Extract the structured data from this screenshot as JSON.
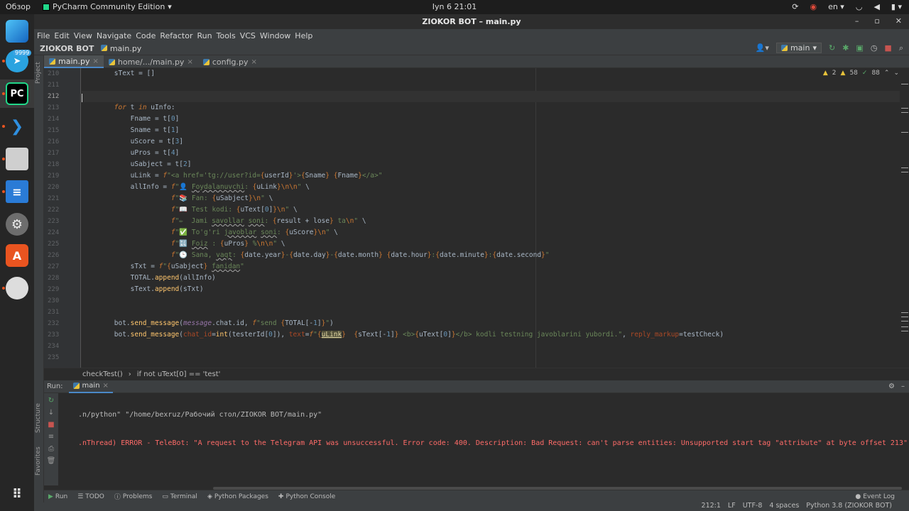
{
  "system": {
    "activities": "Обзор",
    "app_menu": "PyCharm Community Edition",
    "clock": "Iyn 6  21:01",
    "lang": "en"
  },
  "dock": {
    "badge": "9999",
    "pycharm_label": "PC"
  },
  "window": {
    "title": "ZIOKOR BOT – main.py"
  },
  "menu": [
    "File",
    "Edit",
    "View",
    "Navigate",
    "Code",
    "Refactor",
    "Run",
    "Tools",
    "VCS",
    "Window",
    "Help"
  ],
  "nav": {
    "project": "ZIOKOR BOT",
    "file": "main.py",
    "branch": "main"
  },
  "sidebar": {
    "project": "Project",
    "structure": "Structure",
    "favorites": "Favorites"
  },
  "tabs": [
    {
      "label": "main.py"
    },
    {
      "label": "home/.../main.py"
    },
    {
      "label": "config.py"
    }
  ],
  "inspections": {
    "warnings": "2",
    "weak": "58",
    "typos": "88"
  },
  "lines": [
    "210",
    "211",
    "212",
    "213",
    "214",
    "215",
    "216",
    "217",
    "218",
    "219",
    "220",
    "221",
    "222",
    "223",
    "224",
    "225",
    "226",
    "227",
    "228",
    "229",
    "230",
    "231",
    "232",
    "233",
    "234",
    "235"
  ],
  "breadcrumb": [
    "checkTest()",
    "if not uText[0] == 'test'"
  ],
  "run": {
    "label": "Run:",
    "tab": "main",
    "line1": ".n/python\" \"/home/bexruz/Рабочий стол/ZIOKOR BOT/main.py\"",
    "line2": ".nThread) ERROR - TeleBot: \"A request to the Telegram API was unsuccessful. Error code: 400. Description: Bad Request: can't parse entities: Unsupported start tag \"attribute\" at byte offset 213\""
  },
  "bottom_tabs": [
    "Run",
    "TODO",
    "Problems",
    "Terminal",
    "Python Packages",
    "Python Console"
  ],
  "event_log": "Event Log",
  "status": [
    "212:1",
    "LF",
    "UTF-8",
    "4 spaces",
    "Python 3.8 (ZIOKOR BOT)"
  ],
  "colors": {
    "accent": "#4a88c7",
    "error": "#ff6b68",
    "keyword": "#cc7832",
    "string": "#6a8759"
  }
}
